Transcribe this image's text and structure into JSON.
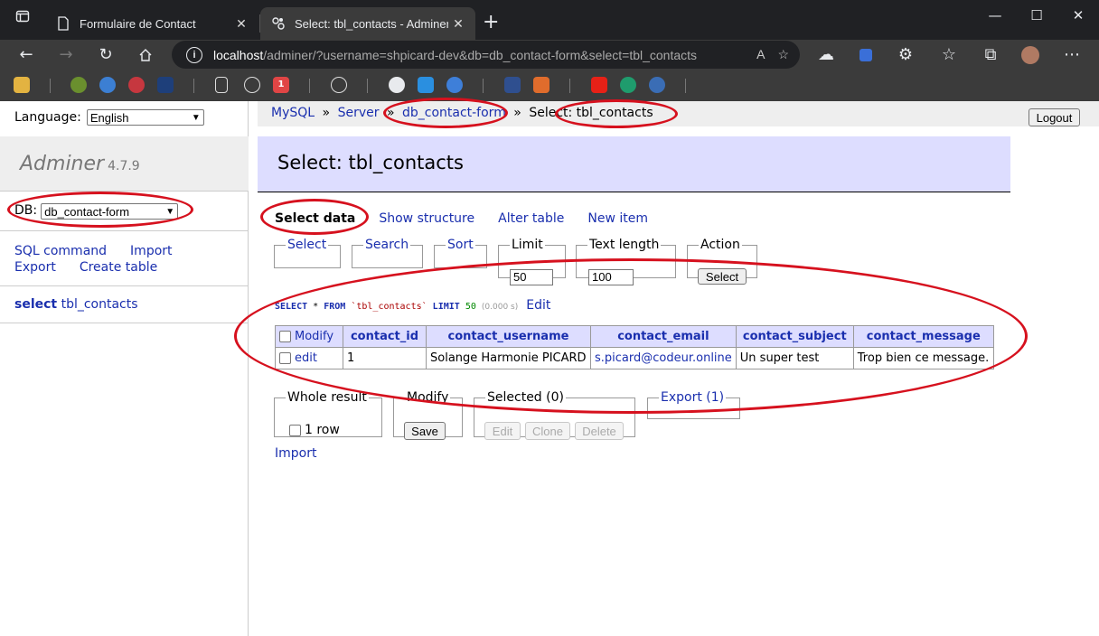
{
  "browser": {
    "tabs": [
      {
        "title": "Formulaire de Contact",
        "active": false
      },
      {
        "title": "Select: tbl_contacts - Adminer",
        "active": true
      }
    ],
    "url": {
      "host": "localhost",
      "path": "/adminer/?username=shpicard-dev&db=db_contact-form&select=tbl_contacts"
    },
    "bookmark_badge": "1"
  },
  "sidebar": {
    "language_label": "Language:",
    "language_value": "English",
    "brand_name": "Adminer",
    "brand_version": "4.7.9",
    "db_label": "DB:",
    "db_value": "db_contact-form",
    "links": {
      "sql_command": "SQL command",
      "import": "Import",
      "export": "Export",
      "create_table": "Create table"
    },
    "table_action": "select",
    "table_name": "tbl_contacts"
  },
  "breadcrumb": {
    "mysql": "MySQL",
    "sep": "»",
    "server": "Server",
    "db": "db_contact-form",
    "current": "Select: tbl_contacts"
  },
  "logout_label": "Logout",
  "heading": "Select: tbl_contacts",
  "table_links": {
    "select_data": "Select data",
    "show_structure": "Show structure",
    "alter_table": "Alter table",
    "new_item": "New item"
  },
  "filters": {
    "select": "Select",
    "search": "Search",
    "sort": "Sort",
    "limit_label": "Limit",
    "limit_value": "50",
    "text_length_label": "Text length",
    "text_length_value": "100",
    "action_label": "Action",
    "action_button": "Select"
  },
  "query": {
    "select_kw": "SELECT",
    "star": "*",
    "from_kw": "FROM",
    "table": "`tbl_contacts`",
    "limit_kw": "LIMIT",
    "limit_val": "50",
    "time": "(0.000 s)",
    "edit": "Edit"
  },
  "results": {
    "modify_header": "Modify",
    "columns": [
      "contact_id",
      "contact_username",
      "contact_email",
      "contact_subject",
      "contact_message"
    ],
    "rows": [
      {
        "edit": "edit",
        "contact_id": "1",
        "contact_username": "Solange Harmonie PICARD",
        "contact_email": "s.picard@codeur.online",
        "contact_subject": "Un super test",
        "contact_message": "Trop bien ce message."
      }
    ]
  },
  "bottom": {
    "whole_result": "Whole result",
    "rows_count": "1 row",
    "modify": "Modify",
    "save": "Save",
    "selected": "Selected (0)",
    "edit": "Edit",
    "clone": "Clone",
    "delete": "Delete",
    "export": "Export (1)",
    "import": "Import"
  },
  "colors": {
    "link": "#1a2fae",
    "heading_bg": "#ddf",
    "annotation": "#d6111e"
  }
}
